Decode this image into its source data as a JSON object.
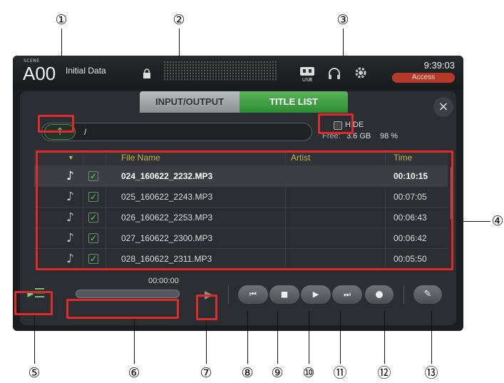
{
  "callouts": [
    "①",
    "②",
    "③",
    "④",
    "⑤",
    "⑥",
    "⑦",
    "⑧",
    "⑨",
    "⑩",
    "⑪",
    "⑫",
    "⑬"
  ],
  "topbar": {
    "scene_label": "SCENE",
    "scene_number": "A00",
    "scene_title": "Initial Data",
    "clock": "9:39:03",
    "access_label": "Access",
    "usb_label": "USB"
  },
  "tabs": {
    "io": "INPUT/OUTPUT",
    "title_list": "TITLE LIST"
  },
  "close_label": "×",
  "path": {
    "up_label": "↑",
    "current": "/"
  },
  "storage": {
    "hide_label": "HIDE",
    "free_label": "Free:",
    "free_value": "3.6 GB",
    "free_percent": "98 %"
  },
  "table": {
    "headers": {
      "sort": "▼",
      "file_name": "File Name",
      "artist": "Artist",
      "time": "Time"
    },
    "rows": [
      {
        "file": "024_160622_2232.MP3",
        "artist": "",
        "time": "00:10:15",
        "selected": true
      },
      {
        "file": "025_160622_2243.MP3",
        "artist": "",
        "time": "00:07:05",
        "selected": false
      },
      {
        "file": "026_160622_2253.MP3",
        "artist": "",
        "time": "00:06:43",
        "selected": false
      },
      {
        "file": "027_160622_2300.MP3",
        "artist": "",
        "time": "00:06:42",
        "selected": false
      },
      {
        "file": "028_160622_2311.MP3",
        "artist": "",
        "time": "00:05:50",
        "selected": false
      }
    ]
  },
  "transport": {
    "elapsed": "00:00:00",
    "progress": 0.0,
    "rewind_label": "⏮",
    "stop_label": "■",
    "play_label": "▶",
    "ffwd_label": "⏭",
    "edit_label": "✎"
  },
  "colors": {
    "highlight": "#e02a2a",
    "tab_active": "#3a9c3f",
    "access": "#b23a2a",
    "header_text": "#c6b04a"
  }
}
